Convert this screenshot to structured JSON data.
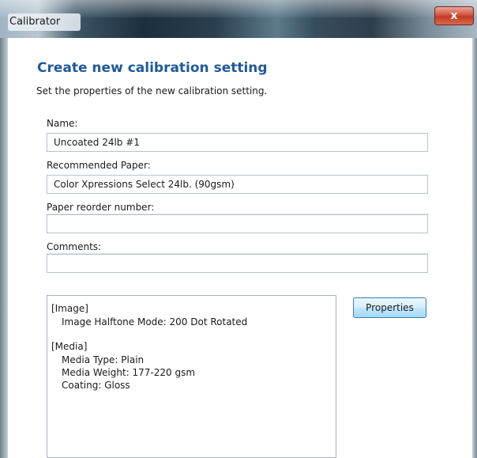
{
  "window": {
    "title": "Calibrator",
    "close_glyph": "x"
  },
  "main": {
    "heading": "Create new calibration setting",
    "subheading": "Set the properties of the new calibration setting."
  },
  "fields": {
    "name": {
      "label": "Name:",
      "value": "Uncoated 24lb #1"
    },
    "recommended_paper": {
      "label": "Recommended Paper:",
      "value": "Color Xpressions Select 24lb. (90gsm)"
    },
    "paper_reorder_number": {
      "label": "Paper reorder number:",
      "value": ""
    },
    "comments": {
      "label": "Comments:",
      "value": ""
    }
  },
  "details": {
    "image_section": "[Image]",
    "image_halftone": "Image Halftone Mode: 200 Dot Rotated",
    "media_section": "[Media]",
    "media_type": "Media Type: Plain",
    "media_weight": "Media Weight: 177-220 gsm",
    "coating": "Coating: Gloss"
  },
  "buttons": {
    "properties": "Properties"
  },
  "colors": {
    "heading": "#1f5a9a",
    "close_button": "#c23b24",
    "button_border": "#3c7fb1"
  },
  "icons": {
    "close": "close-icon"
  }
}
